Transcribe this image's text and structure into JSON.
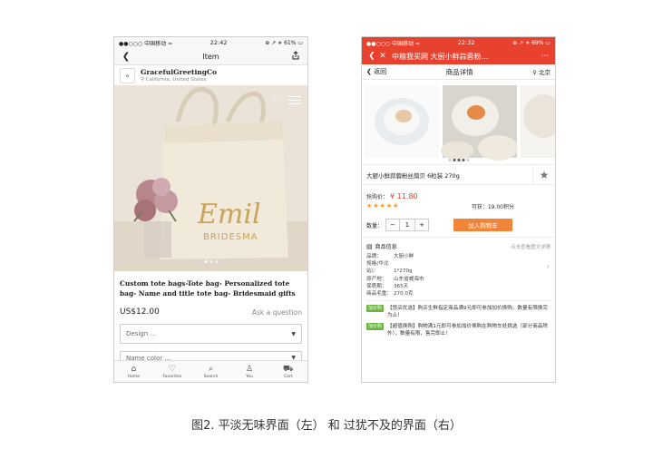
{
  "left": {
    "status": {
      "carrier": "●●○○○ 中国移动 ≈",
      "time": "22:42",
      "battery": "⊕ ↗ ∗ 61% ▭"
    },
    "nav": {
      "title": "Item",
      "back_icon": "chevron-left-icon",
      "share_icon": "share-icon"
    },
    "shop": {
      "name": "GracefulGreetingCo",
      "location": "California, United States"
    },
    "photo": {
      "bag_text_1": "Emil",
      "bag_text_2": "BRIDESMA"
    },
    "product_title": "Custom tote bags-Tote bag- Personalized tote bag- Name and title tote bag- Bridesmaid gifts",
    "price": "US$12.00",
    "ask": "Ask a question",
    "design_label": "Design …",
    "name_color_label": "Name color …",
    "tabs": [
      {
        "label": "Home",
        "icon": "⌂"
      },
      {
        "label": "Favorites",
        "icon": "♡"
      },
      {
        "label": "Search",
        "icon": "⌕"
      },
      {
        "label": "You",
        "icon": "♙"
      },
      {
        "label": "Cart",
        "icon": "⛟"
      }
    ]
  },
  "right": {
    "status": {
      "carrier": "●●○○○ 中国移动 ≈",
      "time": "22:32",
      "battery": "⊕ ↗ ∗ 69% ▭"
    },
    "nav": {
      "title": "中粮我买网 大厨小鲜蒜蓉粉…"
    },
    "sub": {
      "back": "返回",
      "title": "商品详情",
      "location": "北京"
    },
    "product_title": "大厨小鲜蒜蓉粉丝扇贝 6粒装 270g",
    "price_label": "抢购价：",
    "price_value": "¥ 11.80",
    "stars": "★★★★★",
    "points": "可获：19.00积分",
    "qty_label": "数量：",
    "qty_minus": "−",
    "qty_value": "1",
    "qty_plus": "+",
    "add_cart": "加入购物车",
    "info_title": "商品信息",
    "info_more": "点击查看图文详情",
    "specs": [
      {
        "k": "品牌：",
        "v": "大厨小鲜"
      },
      {
        "k": "规格(华北站)：",
        "v": "1*270g"
      },
      {
        "k": "原产地：",
        "v": "山东省威海市"
      },
      {
        "k": "保质期：",
        "v": "365天"
      },
      {
        "k": "商品毛重：",
        "v": "270.0克"
      }
    ],
    "promos": [
      {
        "badge": "加价购",
        "text": "【悠买优选】购买生鲜指定商品满9元即可参加加价换购，数量有限换完为止！"
      },
      {
        "badge": "加价购",
        "text": "【超值换购】购物满1元即可参加加价换购在购物车处挑选（部分商品除外），数量有限，售完即止！"
      }
    ]
  },
  "caption": "图2. 平淡无味界面（左） 和 过犹不及的界面（右）"
}
